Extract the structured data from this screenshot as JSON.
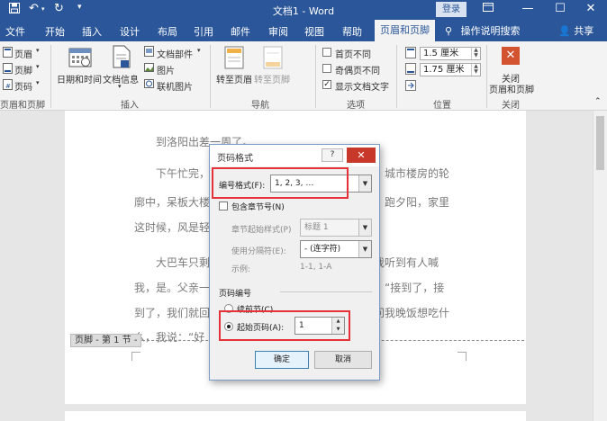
{
  "window": {
    "title": "文档1 - Word",
    "login_label": "登录"
  },
  "tabs": [
    "文件",
    "开始",
    "插入",
    "设计",
    "布局",
    "引用",
    "邮件",
    "审阅",
    "视图",
    "帮助",
    "页眉和页脚"
  ],
  "tell_me": "操作说明搜索",
  "share": "共享",
  "ribbon": {
    "header_footer_group": {
      "header": "页眉",
      "footer": "页脚",
      "page_number": "页码",
      "label": "页眉和页脚"
    },
    "insert_group": {
      "date_time": "日期和时间",
      "doc_info": "文档信息",
      "doc_parts": "文档部件",
      "picture": "图片",
      "online_picture": "联机图片",
      "label": "插入"
    },
    "nav_group": {
      "goto_header": "转至页眉",
      "goto_footer": "转至页脚",
      "label": "导航"
    },
    "options_group": {
      "first_page": "首页不同",
      "odd_even": "奇偶页不同",
      "show_text": "显示文档文字",
      "first_page_checked": false,
      "odd_even_checked": false,
      "show_text_checked": true,
      "label": "选项"
    },
    "position_group": {
      "header_pos": "1.5 厘米",
      "footer_pos": "1.75 厘米",
      "label": "位置"
    },
    "close_group": {
      "close_label": "关闭",
      "close_label2": "页眉和页脚",
      "label": "关闭"
    }
  },
  "document": {
    "lines": [
      "到洛阳出差一周了。",
      "下午忙完，",
      "城市楼房的轮",
      "廓中，呆板大楼",
      "跑夕阳，家里",
      "这时候，风是轻",
      "大巴车只剩",
      "我听到有人喊",
      "我，是。父亲一",
      "“接到了，接",
      "到了，我们就回",
      "问我晚饭想吃什",
      "么，我说：“好"
    ],
    "footer_label": "页脚 - 第 1 节 -"
  },
  "dialog": {
    "title": "页码格式",
    "help_label": "?",
    "number_format_label": "编号格式(F):",
    "number_format_value": "1, 2, 3, …",
    "include_chapter_label": "包含章节号(N)",
    "include_chapter_checked": false,
    "chapter_style_label": "章节起始样式(P)",
    "chapter_style_value": "标题 1",
    "separator_label": "使用分隔符(E):",
    "separator_value": "-  (连字符)",
    "example_label": "示例:",
    "example_value": "1-1, 1-A",
    "page_numbering_label": "页码编号",
    "continue_label": "续前节(C)",
    "start_at_label": "起始页码(A):",
    "start_at_value": "1",
    "ok_label": "确定",
    "cancel_label": "取消",
    "selected_numbering": "start_at"
  },
  "colors": {
    "title_bar": "#2b579a",
    "highlight_box": "#e5323a",
    "close_button": "#c8382a"
  },
  "icons": [
    "save-icon",
    "undo-icon",
    "redo-icon",
    "customize-icon",
    "minimize-icon",
    "restore-icon",
    "close-icon",
    "lightbulb-icon",
    "person-icon",
    "help-icon"
  ]
}
